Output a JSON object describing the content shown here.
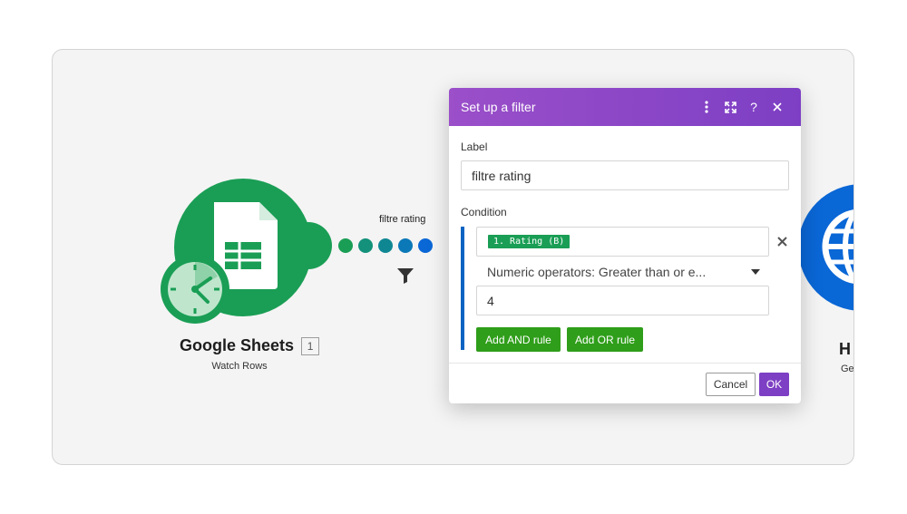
{
  "canvas": {
    "modules": [
      {
        "app": "Google Sheets",
        "badge": "1",
        "action": "Watch Rows",
        "icons": [
          "google-sheets-icon",
          "clock-icon"
        ],
        "color": "#1a9e55"
      },
      {
        "app": "H",
        "action": "Ge",
        "icons": [
          "globe-icon"
        ],
        "color": "#0a67d6"
      }
    ],
    "route": {
      "label": "filtre rating",
      "dot_colors": [
        "#1a9e55",
        "#13917a",
        "#0f8793",
        "#0b78b8",
        "#0a67d6"
      ],
      "icons": [
        "filter-icon"
      ]
    }
  },
  "dialog": {
    "title": "Set up a filter",
    "header_color": "#8e47c8",
    "toolbar_icons": [
      "more-vert-icon",
      "expand-icon",
      "help-icon",
      "close-icon"
    ],
    "label_field": {
      "label": "Label",
      "value": "filtre rating"
    },
    "condition": {
      "label": "Condition",
      "field_pill": "1. Rating (B)",
      "operator": "Numeric operators: Greater than or e...",
      "value": "4",
      "add_and_label": "Add AND rule",
      "add_or_label": "Add OR rule"
    },
    "footer": {
      "cancel_label": "Cancel",
      "ok_label": "OK"
    }
  }
}
